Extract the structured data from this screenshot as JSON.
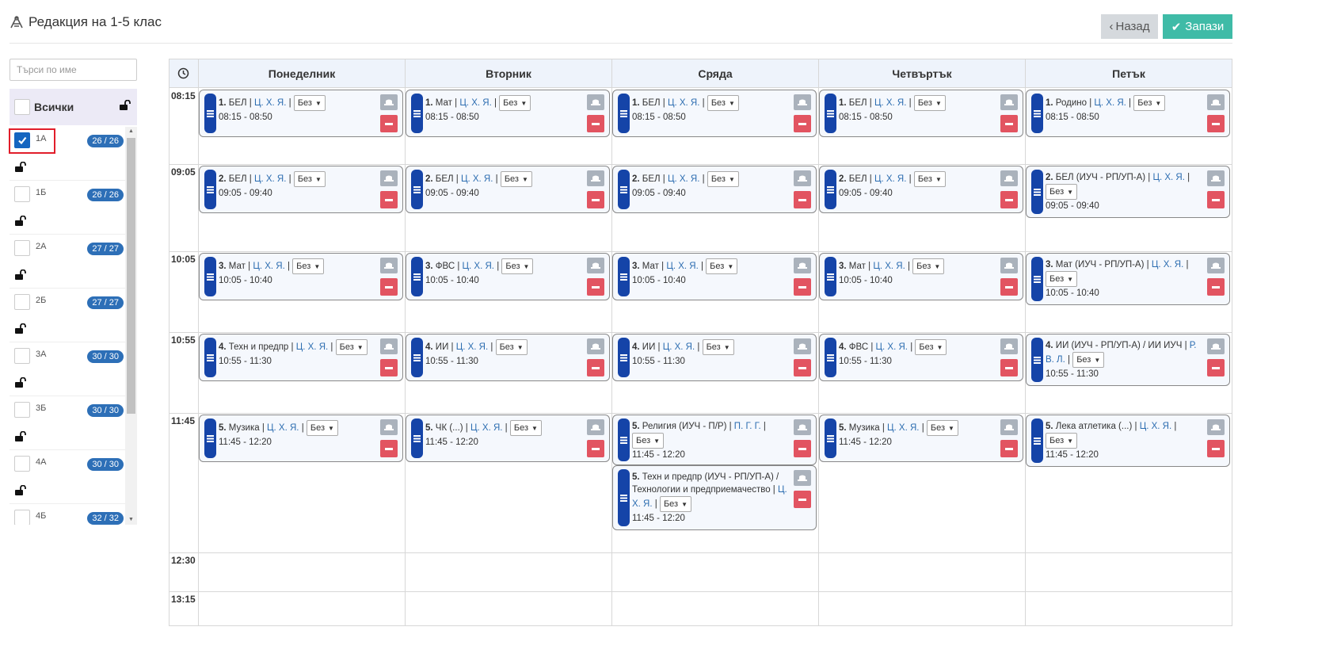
{
  "header": {
    "title": "Редакция на 1-5 клас",
    "back_label": "Назад",
    "save_label": "Запази"
  },
  "sidebar": {
    "search_placeholder": "Търси по име",
    "all_label": "Всички",
    "classes": [
      {
        "name": "1А",
        "count": "26 / 26",
        "checked": true
      },
      {
        "name": "1Б",
        "count": "26 / 26",
        "checked": false
      },
      {
        "name": "2А",
        "count": "27 / 27",
        "checked": false
      },
      {
        "name": "2Б",
        "count": "27 / 27",
        "checked": false
      },
      {
        "name": "3А",
        "count": "30 / 30",
        "checked": false
      },
      {
        "name": "3Б",
        "count": "30 / 30",
        "checked": false
      },
      {
        "name": "4А",
        "count": "30 / 30",
        "checked": false
      },
      {
        "name": "4Б",
        "count": "32 / 32",
        "checked": false
      }
    ]
  },
  "schedule": {
    "days": [
      "Понеделник",
      "Вторник",
      "Сряда",
      "Четвъртък",
      "Петък"
    ],
    "times": [
      "08:15",
      "09:05",
      "10:05",
      "10:55",
      "11:45",
      "12:30",
      "13:15"
    ],
    "lessons": [
      {
        "day": 0,
        "slot": 0,
        "num": "1.",
        "subject": "БЕЛ",
        "teacher": "Ц. Х. Я.",
        "select": "Без",
        "time": "08:15 - 08:50",
        "wrap": false
      },
      {
        "day": 1,
        "slot": 0,
        "num": "1.",
        "subject": "Мат",
        "teacher": "Ц. Х. Я.",
        "select": "Без",
        "time": "08:15 - 08:50",
        "wrap": false
      },
      {
        "day": 2,
        "slot": 0,
        "num": "1.",
        "subject": "БЕЛ",
        "teacher": "Ц. Х. Я.",
        "select": "Без",
        "time": "08:15 - 08:50",
        "wrap": false
      },
      {
        "day": 3,
        "slot": 0,
        "num": "1.",
        "subject": "БЕЛ",
        "teacher": "Ц. Х. Я.",
        "select": "Без",
        "time": "08:15 - 08:50",
        "wrap": false
      },
      {
        "day": 4,
        "slot": 0,
        "num": "1.",
        "subject": "Родино",
        "teacher": "Ц. Х. Я.",
        "select": "Без",
        "time": "08:15 - 08:50",
        "wrap": false
      },
      {
        "day": 0,
        "slot": 1,
        "num": "2.",
        "subject": "БЕЛ",
        "teacher": "Ц. Х. Я.",
        "select": "Без",
        "time": "09:05 - 09:40",
        "wrap": false
      },
      {
        "day": 1,
        "slot": 1,
        "num": "2.",
        "subject": "БЕЛ",
        "teacher": "Ц. Х. Я.",
        "select": "Без",
        "time": "09:05 - 09:40",
        "wrap": false
      },
      {
        "day": 2,
        "slot": 1,
        "num": "2.",
        "subject": "БЕЛ",
        "teacher": "Ц. Х. Я.",
        "select": "Без",
        "time": "09:05 - 09:40",
        "wrap": false
      },
      {
        "day": 3,
        "slot": 1,
        "num": "2.",
        "subject": "БЕЛ",
        "teacher": "Ц. Х. Я.",
        "select": "Без",
        "time": "09:05 - 09:40",
        "wrap": false
      },
      {
        "day": 4,
        "slot": 1,
        "num": "2.",
        "subject": "БЕЛ (ИУЧ - РП/УП-А)",
        "teacher": "Ц. Х. Я.",
        "select": "Без",
        "time": "09:05 - 09:40",
        "wrap": true
      },
      {
        "day": 0,
        "slot": 2,
        "num": "3.",
        "subject": "Мат",
        "teacher": "Ц. Х. Я.",
        "select": "Без",
        "time": "10:05 - 10:40",
        "wrap": false
      },
      {
        "day": 1,
        "slot": 2,
        "num": "3.",
        "subject": "ФВС",
        "teacher": "Ц. Х. Я.",
        "select": "Без",
        "time": "10:05 - 10:40",
        "wrap": false
      },
      {
        "day": 2,
        "slot": 2,
        "num": "3.",
        "subject": "Мат",
        "teacher": "Ц. Х. Я.",
        "select": "Без",
        "time": "10:05 - 10:40",
        "wrap": false
      },
      {
        "day": 3,
        "slot": 2,
        "num": "3.",
        "subject": "Мат",
        "teacher": "Ц. Х. Я.",
        "select": "Без",
        "time": "10:05 - 10:40",
        "wrap": false
      },
      {
        "day": 4,
        "slot": 2,
        "num": "3.",
        "subject": "Мат (ИУЧ - РП/УП-А)",
        "teacher": "Ц. Х. Я.",
        "select": "Без",
        "time": "10:05 - 10:40",
        "wrap": true
      },
      {
        "day": 0,
        "slot": 3,
        "num": "4.",
        "subject": "Техн и предпр",
        "teacher": "Ц. Х. Я.",
        "select": "Без",
        "time": "10:55 - 11:30",
        "wrap": false
      },
      {
        "day": 1,
        "slot": 3,
        "num": "4.",
        "subject": "ИИ",
        "teacher": "Ц. Х. Я.",
        "select": "Без",
        "time": "10:55 - 11:30",
        "wrap": false
      },
      {
        "day": 2,
        "slot": 3,
        "num": "4.",
        "subject": "ИИ",
        "teacher": "Ц. Х. Я.",
        "select": "Без",
        "time": "10:55 - 11:30",
        "wrap": false
      },
      {
        "day": 3,
        "slot": 3,
        "num": "4.",
        "subject": "ФВС",
        "teacher": "Ц. Х. Я.",
        "select": "Без",
        "time": "10:55 - 11:30",
        "wrap": false
      },
      {
        "day": 4,
        "slot": 3,
        "num": "4.",
        "subject": "ИИ (ИУЧ - РП/УП-А) / ИИ ИУЧ",
        "teacher": "Р. В. Л.",
        "select": "Без",
        "time": "10:55 - 11:30",
        "wrap": true
      },
      {
        "day": 0,
        "slot": 4,
        "num": "5.",
        "subject": "Музика",
        "teacher": "Ц. Х. Я.",
        "select": "Без",
        "time": "11:45 - 12:20",
        "wrap": false
      },
      {
        "day": 1,
        "slot": 4,
        "num": "5.",
        "subject": "ЧК (...)",
        "teacher": "Ц. Х. Я.",
        "select": "Без",
        "time": "11:45 - 12:20",
        "wrap": false
      },
      {
        "day": 2,
        "slot": 4,
        "num": "5.",
        "subject": "Религия (ИУЧ - П/Р)",
        "teacher": "П. Г. Г.",
        "select": "Без",
        "time": "11:45 - 12:20",
        "wrap": true
      },
      {
        "day": 2,
        "slot": 4,
        "num": "5.",
        "subject": "Техн и предпр (ИУЧ - РП/УП-А) / Технологии и предприемачество",
        "teacher": "Ц. Х. Я.",
        "select": "Без",
        "time": "11:45 - 12:20",
        "wrap": true,
        "second": true
      },
      {
        "day": 3,
        "slot": 4,
        "num": "5.",
        "subject": "Музика",
        "teacher": "Ц. Х. Я.",
        "select": "Без",
        "time": "11:45 - 12:20",
        "wrap": false
      },
      {
        "day": 4,
        "slot": 4,
        "num": "5.",
        "subject": "Лека атлетика (...)",
        "teacher": "Ц. Х. Я.",
        "select": "Без",
        "time": "11:45 - 12:20",
        "wrap": true
      }
    ]
  },
  "colors": {
    "accent": "#3fbba7",
    "handle": "#1544a8",
    "badge": "#2d6fb7",
    "remove": "#e25461",
    "header_bg": "#eef3fb",
    "selection_outline": "#e11d2a"
  }
}
